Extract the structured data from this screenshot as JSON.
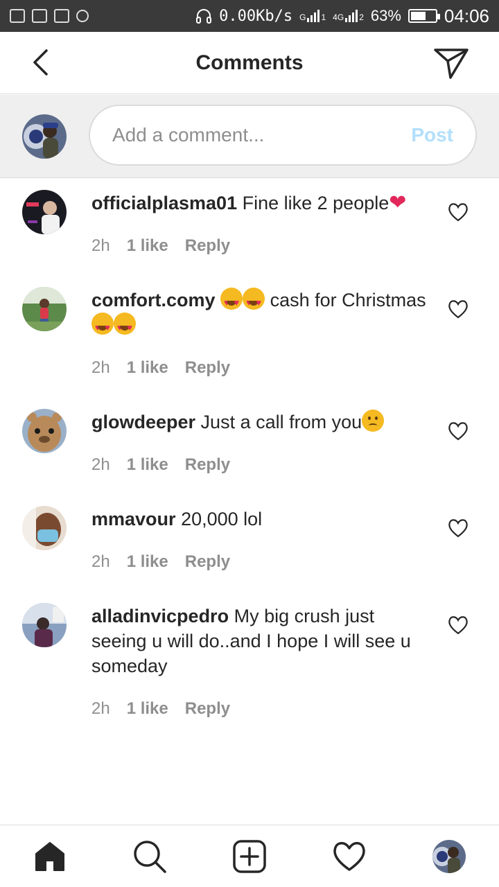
{
  "status_bar": {
    "net_speed": "0.00Kb/s",
    "sim1_label": "G",
    "sim1_index": "1",
    "sim2_label": "4G",
    "sim2_index": "2",
    "battery_percent": "63%",
    "battery_level": 0.63,
    "time": "04:06"
  },
  "header": {
    "title": "Comments",
    "back_icon": "chevron-left-icon",
    "share_icon": "paper-plane-icon"
  },
  "composer": {
    "placeholder": "Add a comment...",
    "value": "",
    "post_label": "Post"
  },
  "comments": [
    {
      "username": "officialplasma01",
      "text": "Fine like 2 people",
      "emoji": [
        "red-heart"
      ],
      "time": "2h",
      "likes": "1 like",
      "reply": "Reply"
    },
    {
      "username": "comfort.comy",
      "text_before": "",
      "text": "cash for Christmas",
      "emoji": [
        "heart-eyes",
        "heart-eyes"
      ],
      "emoji_after": [
        "heart-eyes",
        "heart-eyes"
      ],
      "time": "2h",
      "likes": "1 like",
      "reply": "Reply"
    },
    {
      "username": "glowdeeper",
      "text": "Just a call from you",
      "emoji": [
        "sad-face"
      ],
      "time": "2h",
      "likes": "1 like",
      "reply": "Reply"
    },
    {
      "username": "mmavour",
      "text": "20,000 lol",
      "time": "2h",
      "likes": "1 like",
      "reply": "Reply"
    },
    {
      "username": "alladinvicpedro",
      "text": "My big crush just seeing u will do..and I hope I will see u someday",
      "time": "2h",
      "likes": "1 like",
      "reply": "Reply"
    }
  ],
  "bottom_nav": {
    "items": [
      "home-icon",
      "search-icon",
      "add-post-icon",
      "activity-heart-icon",
      "profile-avatar"
    ]
  },
  "colors": {
    "post_disabled": "#b2dffc",
    "meta_gray": "#8e8e8e",
    "heart_red": "#e2285a"
  }
}
